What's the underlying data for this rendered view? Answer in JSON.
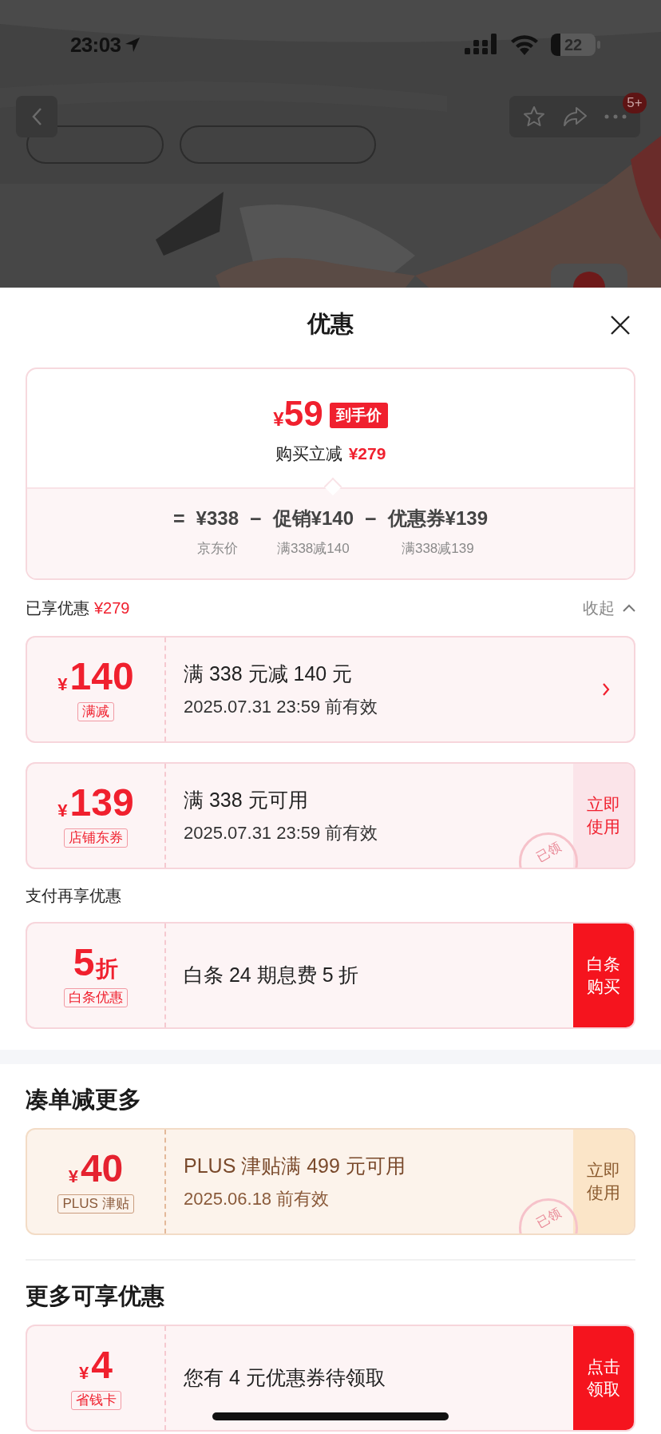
{
  "status_bar": {
    "time": "23:03",
    "battery": "22"
  },
  "nav": {
    "badge": "5+"
  },
  "sheet": {
    "title": "优惠"
  },
  "price_card": {
    "currency": "¥",
    "price": "59",
    "badge": "到手价",
    "saving_label": "购买立减",
    "saving_amount": "¥279",
    "breakdown": [
      {
        "operator": "=",
        "amount": "¥338",
        "note": "京东价"
      },
      {
        "operator": "−",
        "amount": "促销¥140",
        "note": "满338减140"
      },
      {
        "operator": "−",
        "amount": "优惠券¥139",
        "note": "满338减139"
      }
    ]
  },
  "enjoyed": {
    "label": "已享优惠",
    "amount": "¥279",
    "toggle": "收起",
    "expanded": true
  },
  "sections": [
    {
      "coupons": [
        {
          "kind": "standard",
          "currency": "¥",
          "value": "140",
          "tag": "满减",
          "title": "满 338 元减 140 元",
          "date": "2025.07.31 23:59 前有效",
          "action": {
            "kind": "arrow"
          }
        },
        {
          "kind": "standard",
          "currency": "¥",
          "value": "139",
          "tag": "店铺东券",
          "title": "满 338 元可用",
          "date": "2025.07.31 23:59 前有效",
          "stamp": "已领",
          "action": {
            "kind": "use",
            "label": "立即使用"
          }
        }
      ]
    },
    {
      "heading": "支付再享优惠",
      "coupons": [
        {
          "kind": "standard",
          "value": "5",
          "unit": "折",
          "tag": "白条优惠",
          "title": "白条 24 期息费 5 折",
          "action": {
            "kind": "pay",
            "label": "白条购买"
          }
        }
      ]
    },
    {
      "heading": "凑单减更多",
      "coupons": [
        {
          "kind": "plus",
          "currency": "¥",
          "value": "40",
          "tag": "PLUS 津贴",
          "title": "PLUS 津贴满 499 元可用",
          "date": "2025.06.18 前有效",
          "stamp": "已领",
          "action": {
            "kind": "use",
            "label": "立即使用"
          }
        }
      ]
    },
    {
      "heading": "更多可享优惠",
      "coupons": [
        {
          "kind": "standard",
          "currency": "¥",
          "value": "4",
          "tag": "省钱卡",
          "title": "您有 4 元优惠券待领取",
          "action": {
            "kind": "claim",
            "label": "点击领取"
          }
        }
      ]
    }
  ]
}
